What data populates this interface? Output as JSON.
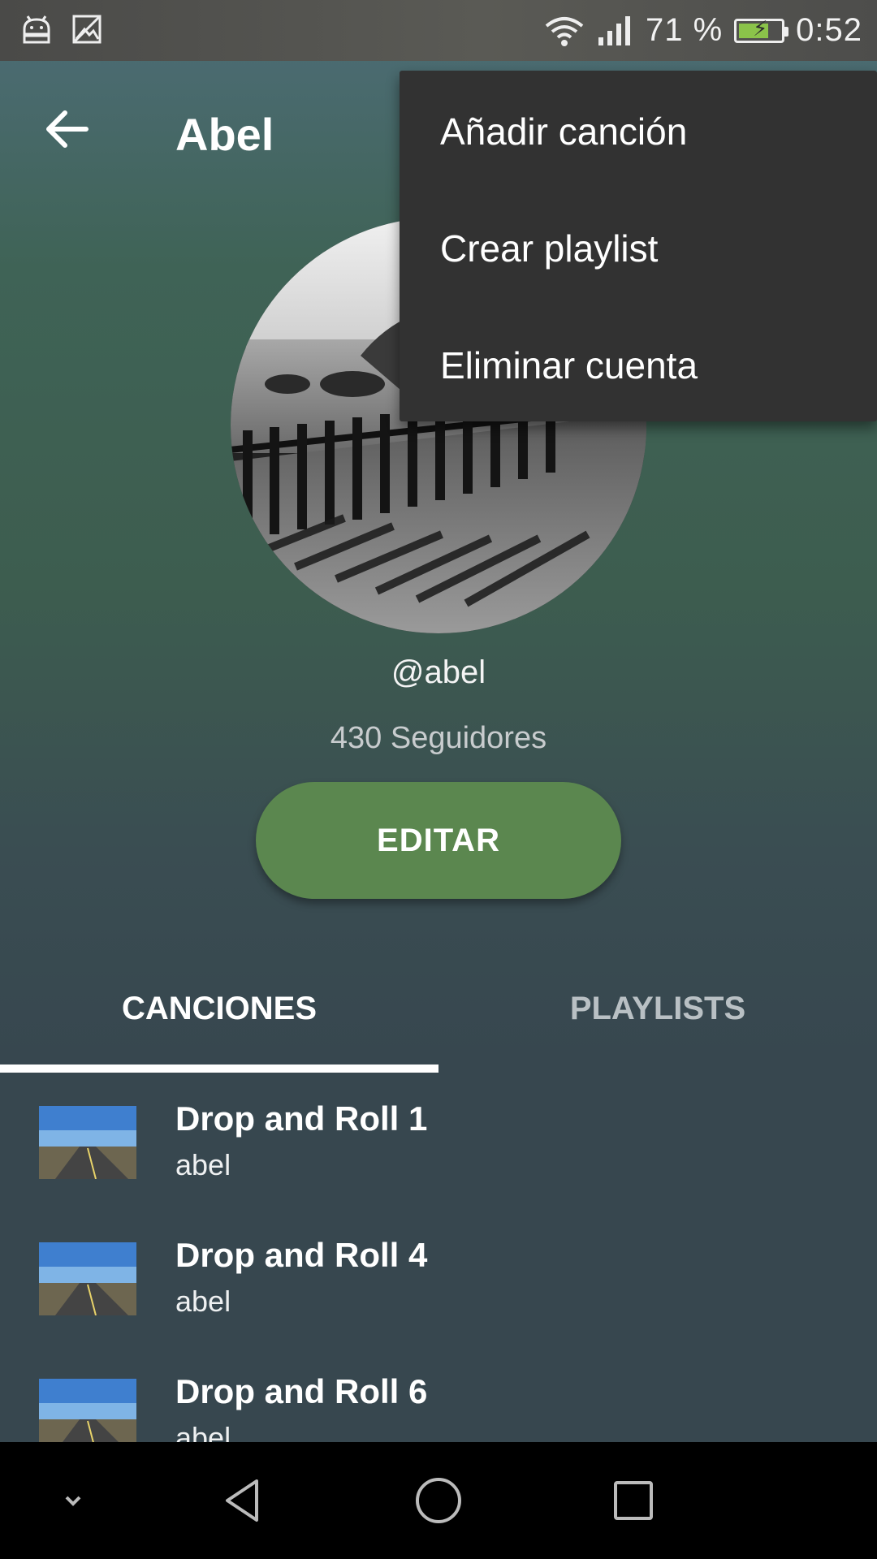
{
  "status_bar": {
    "battery_percent": "71 %",
    "battery_level": 0.71,
    "time": "0:52",
    "icons": [
      "android-icon",
      "image-icon",
      "wifi-icon",
      "signal-icon",
      "battery-charging-icon"
    ]
  },
  "toolbar": {
    "title": "Abel",
    "back_icon": "arrow-back-icon"
  },
  "profile": {
    "username": "@abel",
    "followers": "430 Seguidores",
    "edit_label": "EDITAR"
  },
  "tabs": [
    {
      "label": "CANCIONES",
      "active": true
    },
    {
      "label": "PLAYLISTS",
      "active": false
    }
  ],
  "songs": [
    {
      "title": "Drop and Roll 1",
      "artist": "abel"
    },
    {
      "title": "Drop and Roll 4",
      "artist": "abel"
    },
    {
      "title": "Drop and Roll 6",
      "artist": "abel"
    }
  ],
  "menu": {
    "items": [
      "Añadir canción",
      "Crear playlist",
      "Eliminar cuenta"
    ]
  },
  "nav_bar": {
    "icons": [
      "chevron-down-icon",
      "back-triangle-icon",
      "home-circle-icon",
      "recents-square-icon"
    ]
  },
  "colors": {
    "edit_button": "#5b874f",
    "menu_bg": "#323232",
    "list_bg": "#37474f"
  }
}
